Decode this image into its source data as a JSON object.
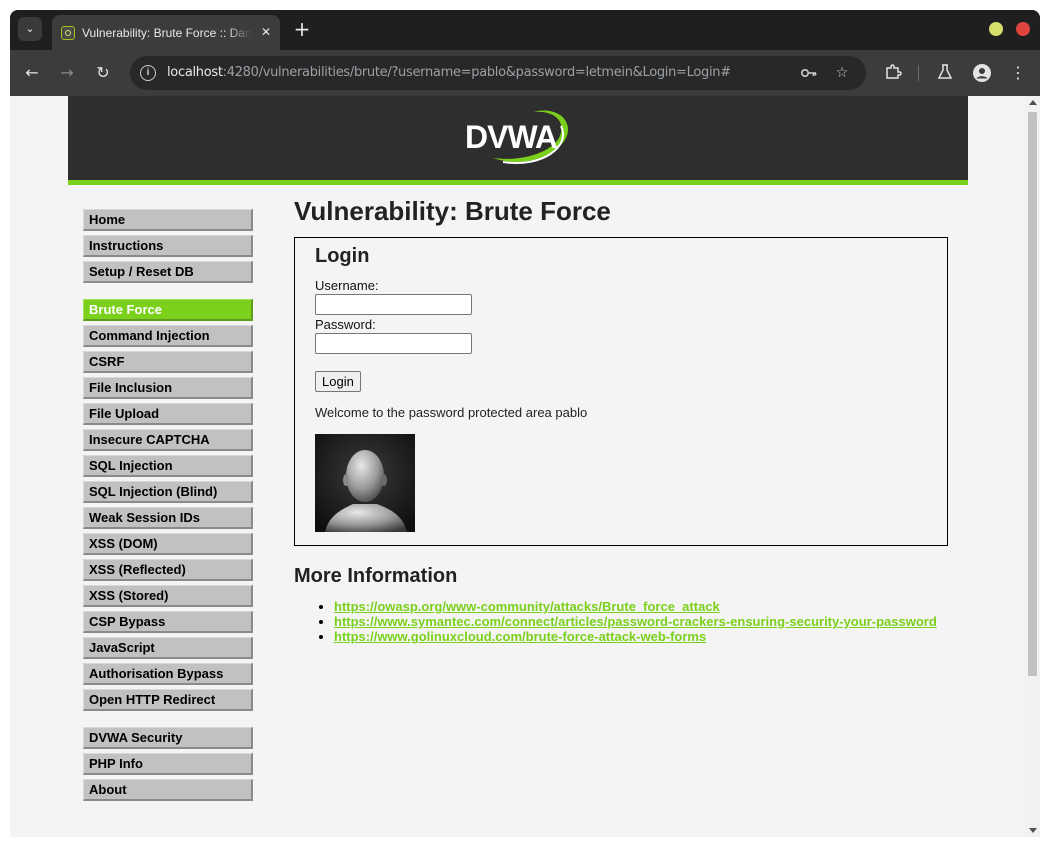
{
  "browser": {
    "tab_title": "Vulnerability: Brute Force :: Damn Vulnerable Web Application (DVWA)",
    "url_host": "localhost",
    "url_rest": ":4280/vulnerabilities/brute/?username=pablo&password=letmein&Login=Login#",
    "colors": {
      "tab_bar": "#1f1f1f",
      "toolbar": "#3c3c3c",
      "minimize": "#d5e06a",
      "close": "#e0443e"
    }
  },
  "header": {
    "logo_text": "DVWA",
    "accent": "#7ad01b"
  },
  "menu": {
    "groups": [
      {
        "items": [
          "Home",
          "Instructions",
          "Setup / Reset DB"
        ]
      },
      {
        "items": [
          "Brute Force",
          "Command Injection",
          "CSRF",
          "File Inclusion",
          "File Upload",
          "Insecure CAPTCHA",
          "SQL Injection",
          "SQL Injection (Blind)",
          "Weak Session IDs",
          "XSS (DOM)",
          "XSS (Reflected)",
          "XSS (Stored)",
          "CSP Bypass",
          "JavaScript",
          "Authorisation Bypass",
          "Open HTTP Redirect"
        ]
      },
      {
        "items": [
          "DVWA Security",
          "PHP Info",
          "About"
        ]
      }
    ],
    "selected": "Brute Force"
  },
  "main": {
    "title": "Vulnerability: Brute Force",
    "login": {
      "heading": "Login",
      "username_label": "Username:",
      "username_value": "",
      "password_label": "Password:",
      "password_value": "",
      "button": "Login",
      "welcome": "Welcome to the password protected area pablo"
    },
    "more_info": {
      "heading": "More Information",
      "links": [
        "https://owasp.org/www-community/attacks/Brute_force_attack",
        "https://www.symantec.com/connect/articles/password-crackers-ensuring-security-your-password",
        "https://www.golinuxcloud.com/brute-force-attack-web-forms"
      ]
    }
  }
}
